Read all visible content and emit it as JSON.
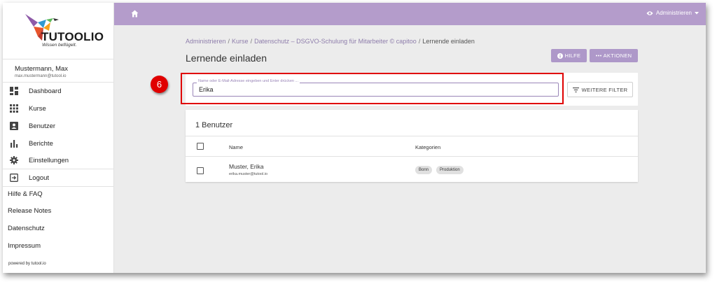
{
  "logo": {
    "name": "TUTOOLIO",
    "tagline": "Wissen beflügelt."
  },
  "user": {
    "name": "Mustermann, Max",
    "email": "max.mustermann@tutool.io"
  },
  "nav": [
    {
      "label": "Dashboard",
      "icon": "dashboard-icon"
    },
    {
      "label": "Kurse",
      "icon": "grid-icon"
    },
    {
      "label": "Benutzer",
      "icon": "user-badge-icon"
    },
    {
      "label": "Berichte",
      "icon": "bar-chart-icon"
    },
    {
      "label": "Einstellungen",
      "icon": "gear-icon"
    },
    {
      "label": "Logout",
      "icon": "logout-icon"
    }
  ],
  "links": [
    "Hilfe & FAQ",
    "Release Notes",
    "Datenschutz",
    "Impressum"
  ],
  "powered": "powered by tutool.io",
  "topbar": {
    "admin_label": "Administrieren",
    "color": "#b49ccb"
  },
  "breadcrumb": {
    "items": [
      "Administrieren",
      "Kurse",
      "Datenschutz – DSGVO-Schulung für Mitarbeiter © capitoo"
    ],
    "current": "Lernende einladen"
  },
  "page": {
    "title": "Lernende einladen",
    "help_label": "HILFE",
    "actions_label": "AKTIONEN"
  },
  "search": {
    "placeholder": "Name oder E-Mail-Adresse eingeben und Enter drücken ...",
    "value": "Erika",
    "filter_label": "WEITERE FILTER"
  },
  "annotation": {
    "step": "6",
    "color": "#e00000"
  },
  "table": {
    "count_label": "1 Benutzer",
    "columns": [
      "Name",
      "Kategorien"
    ],
    "rows": [
      {
        "name": "Muster, Erika",
        "email": "erika.muster@tutool.io",
        "categories": [
          "Bonn",
          "Produktion"
        ]
      }
    ]
  }
}
